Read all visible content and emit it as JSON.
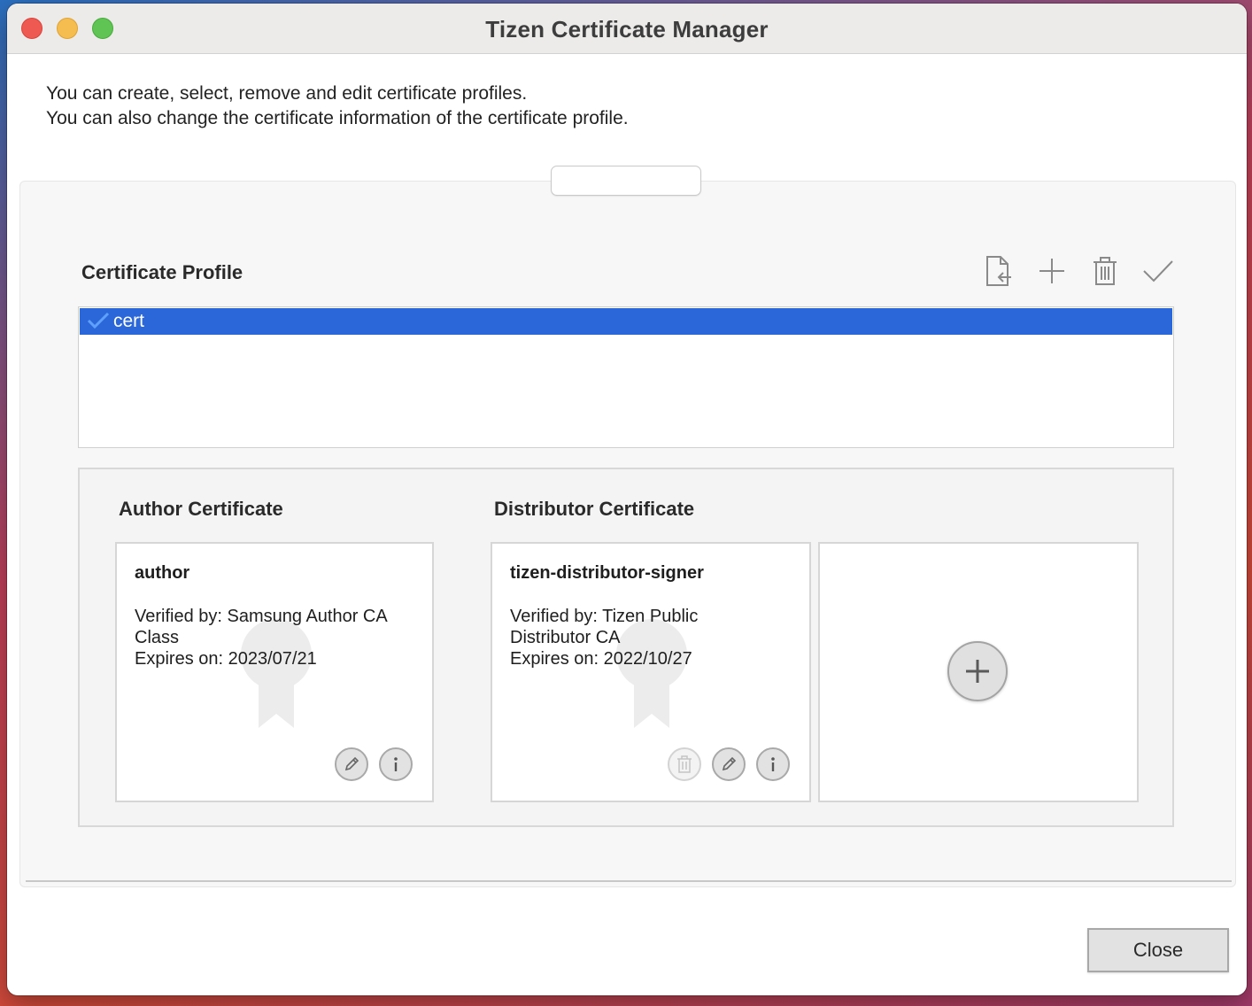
{
  "window": {
    "title": "Tizen Certificate Manager"
  },
  "intro": {
    "line1": "You can create, select, remove and edit certificate profiles.",
    "line2": "You can also change the certificate information of the certificate profile."
  },
  "profile": {
    "title": "Certificate Profile",
    "tools": [
      "import-profile-icon",
      "plus-icon",
      "trash-icon",
      "checkmark-icon"
    ],
    "items": [
      {
        "name": "cert",
        "selected": true,
        "active": true
      }
    ],
    "selection_color": "#2b67d8"
  },
  "author": {
    "title": "Author Certificate",
    "card": {
      "name": "author",
      "verified_line1": "Verified by: Samsung Author CA",
      "verified_line2": "Class",
      "expires": "Expires on: 2023/07/21"
    }
  },
  "distributor": {
    "title": "Distributor Certificate",
    "card": {
      "name": "tizen-distributor-signer",
      "verified_line1": "Verified by: Tizen Public",
      "verified_line2": "Distributor CA",
      "expires": "Expires on: 2022/10/27"
    },
    "delete_enabled": false
  },
  "footer": {
    "close_label": "Close"
  }
}
